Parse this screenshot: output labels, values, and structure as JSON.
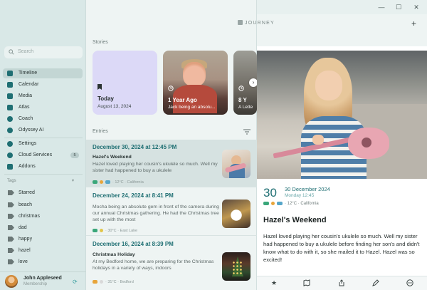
{
  "window": {
    "minimize": "—",
    "maximize": "☐",
    "close": "✕"
  },
  "header": {
    "logo": "JOURNEY",
    "add": "+"
  },
  "sidebar": {
    "search_placeholder": "Search",
    "items": [
      {
        "label": "Timeline",
        "icon": "timeline-icon",
        "active": true
      },
      {
        "label": "Calendar",
        "icon": "calendar-icon"
      },
      {
        "label": "Media",
        "icon": "media-icon"
      },
      {
        "label": "Atlas",
        "icon": "map-icon"
      },
      {
        "label": "Coach",
        "icon": "coach-icon"
      },
      {
        "label": "Odyssey AI",
        "icon": "ai-icon"
      }
    ],
    "items2": [
      {
        "label": "Settings",
        "icon": "gear-icon"
      },
      {
        "label": "Cloud Services",
        "icon": "cloud-icon",
        "badge": "5"
      },
      {
        "label": "Addons",
        "icon": "addons-icon"
      }
    ],
    "tags_title": "Tags",
    "tags": [
      "Starred",
      "beach",
      "christmas",
      "dad",
      "happy",
      "hazel",
      "love"
    ],
    "profile": {
      "name": "John Appleseed",
      "subtitle": "Membership"
    }
  },
  "stories": {
    "title": "Stories",
    "cards": [
      {
        "title": "Today",
        "subtitle": "August 13, 2024"
      },
      {
        "title": "1 Year Ago",
        "subtitle": "Jack being an absolu..."
      },
      {
        "title": "8 Y",
        "subtitle": "A Lette"
      }
    ]
  },
  "entries": {
    "title": "Entries",
    "list": [
      {
        "date": "December 30, 2024 at 12:45 PM",
        "title": "Hazel's Weekend",
        "body": "Hazel loved playing her cousin's ukulele so much. Well my sister had happened to buy a ukulele",
        "meta": "· 12°C · California"
      },
      {
        "date": "December 24, 2024 at 8:41 PM",
        "title": "",
        "body": "Mocha being an absolute gem in front of the camera during our annual Christmas gathering. He had the Christmas tree set up with the most",
        "meta": "· 30°C · East Lake"
      },
      {
        "date": "December 16, 2024 at 8:39 PM",
        "title": "Christmas Holiday",
        "body": "At my Bedford home, we are preparing for the Christmas holidays in a variety of ways, indoors",
        "meta": "· 31°C · Bedford"
      }
    ]
  },
  "detail": {
    "day": "30",
    "date": "30 December 2024",
    "weekday": "Monday 12:45",
    "meta": "· 12°C · California",
    "title": "Hazel's Weekend",
    "body": "Hazel loved playing her cousin's ukulele so much. Well my sister had happened to buy a ukulele before finding her son's and didn't know what to do with it, so she mailed it to Hazel. Hazel was so excited!"
  },
  "colors": {
    "accent": "#1f6f73",
    "sidebar": "#d9e8e7",
    "story_today": "#dcd9f7"
  }
}
